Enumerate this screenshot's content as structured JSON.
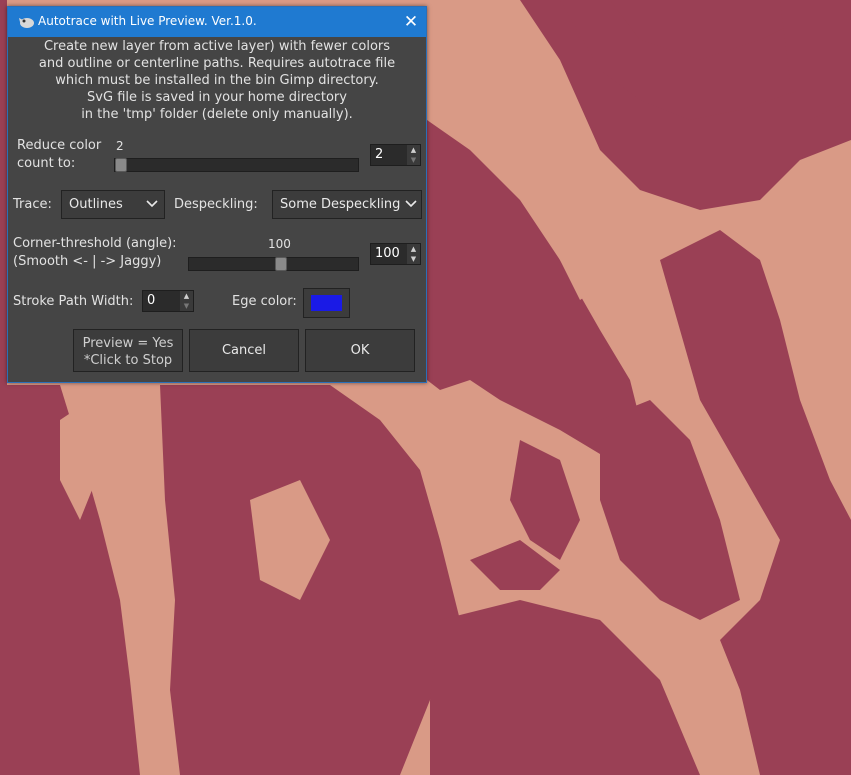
{
  "dialog": {
    "title": "Autotrace with Live Preview. Ver.1.0.",
    "close_label": "✕",
    "description": [
      "Create new layer from active layer) with fewer colors",
      "and outline or centerline paths. Requires autotrace file",
      "which must be installed in the bin Gimp directory.",
      "SvG file is saved in your home directory",
      "in the 'tmp' folder (delete only manually)."
    ],
    "reduce_color": {
      "label_line1": "Reduce color",
      "label_line2": "count to:",
      "slider_value": "2",
      "spin_value": "2",
      "level": 0.0
    },
    "trace": {
      "label": "Trace:",
      "selected": "Outlines"
    },
    "despeckling": {
      "label": "Despeckling:",
      "selected": "Some Despeckling"
    },
    "corner_threshold": {
      "label_line1": "Corner-threshold (angle):",
      "label_line2": "(Smooth <- | -> Jaggy)",
      "slider_value": "100",
      "spin_value": "100",
      "level": 0.55
    },
    "stroke": {
      "label": "Stroke Path Width:",
      "spin_value": "0"
    },
    "edge_color": {
      "label": "Ege color:",
      "color": "#1a1ae6"
    },
    "buttons": {
      "preview_line1": "Preview = Yes",
      "preview_line2": "*Click to Stop",
      "cancel": "Cancel",
      "ok": "OK"
    }
  },
  "colors": {
    "image_dark": "#9a4055",
    "image_light": "#d99a86",
    "title_bar": "#1f7ad1",
    "dialog_bg": "#454545"
  }
}
